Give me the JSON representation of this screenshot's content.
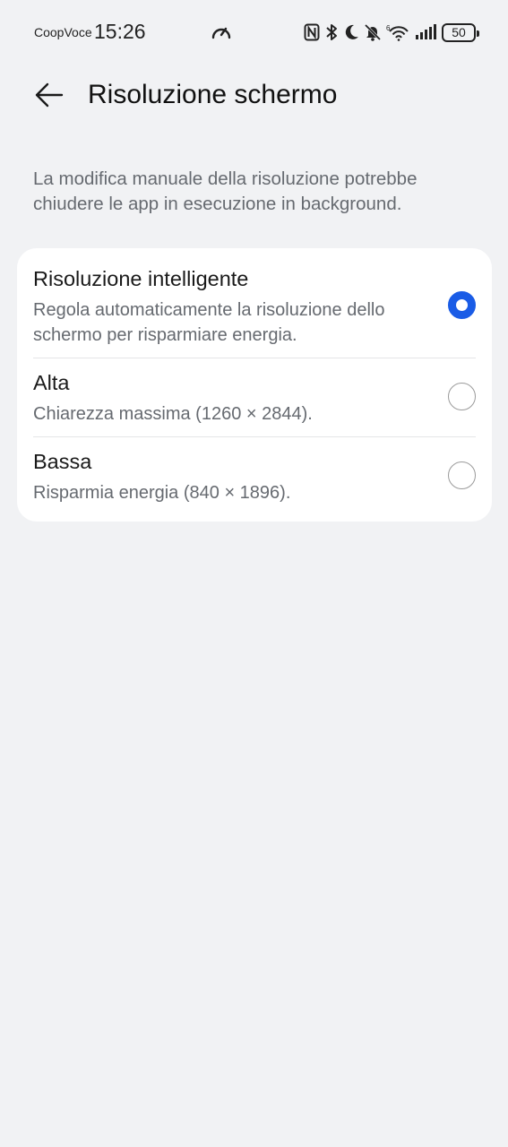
{
  "status_bar": {
    "carrier": "CoopVoce",
    "time": "15:26",
    "battery": "50",
    "icons": [
      "speed-icon",
      "nfc-icon",
      "bluetooth-icon",
      "moon-icon",
      "bell-off-icon",
      "wifi-icon",
      "signal-icon",
      "battery-icon"
    ]
  },
  "header": {
    "back_icon": "arrow-left-icon",
    "title": "Risoluzione schermo"
  },
  "description": "La modifica manuale della risoluzione potrebbe chiudere le app in esecuzione in background.",
  "options": [
    {
      "title": "Risoluzione intelligente",
      "subtitle": "Regola automaticamente la risoluzione dello schermo per risparmiare energia.",
      "selected": true
    },
    {
      "title": "Alta",
      "subtitle": "Chiarezza massima (1260 × 2844).",
      "selected": false
    },
    {
      "title": "Bassa",
      "subtitle": "Risparmia energia (840 × 1896).",
      "selected": false
    }
  ],
  "colors": {
    "background": "#f1f2f4",
    "card": "#ffffff",
    "accent": "#1a5ce6",
    "secondary_text": "#666a70"
  }
}
